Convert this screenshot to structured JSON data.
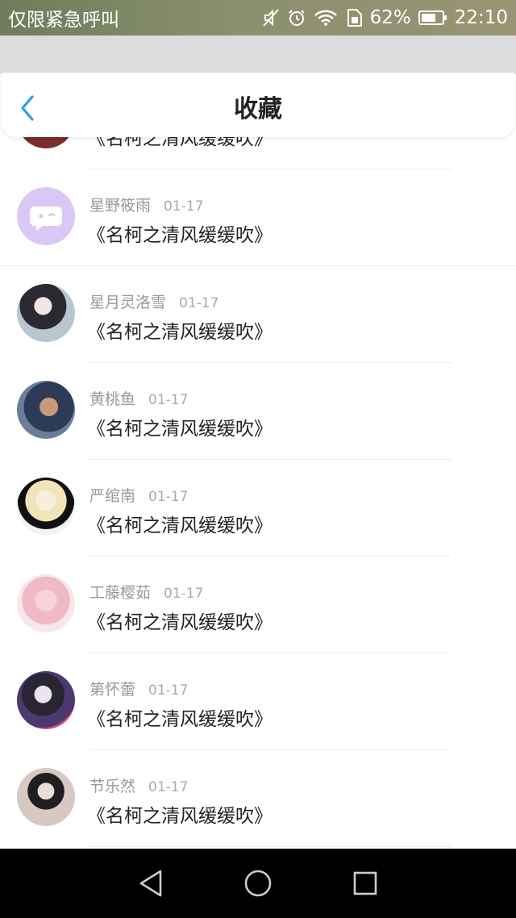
{
  "status_bar": {
    "carrier": "仅限紧急呼叫",
    "battery_percent": "62%",
    "time": "22:10",
    "icons": [
      "mute-icon",
      "alarm-icon",
      "wifi-icon",
      "sim-icon",
      "battery-icon"
    ]
  },
  "header": {
    "title": "收藏",
    "back_icon": "chevron-left-icon",
    "accent_color": "#2a9df4"
  },
  "favorites": [
    {
      "user": "",
      "date": "",
      "work": "《名柯之清风缓缓吹》"
    },
    {
      "user": "星野筱雨",
      "date": "01-17",
      "work": "《名柯之清风缓缓吹》"
    },
    {
      "user": "星月灵洛雪",
      "date": "01-17",
      "work": "《名柯之清风缓缓吹》"
    },
    {
      "user": "黄桃鱼",
      "date": "01-17",
      "work": "《名柯之清风缓缓吹》"
    },
    {
      "user": "严绾南",
      "date": "01-17",
      "work": "《名柯之清风缓缓吹》"
    },
    {
      "user": "工藤樱茹",
      "date": "01-17",
      "work": "《名柯之清风缓缓吹》"
    },
    {
      "user": "第怀蕾",
      "date": "01-17",
      "work": "《名柯之清风缓缓吹》"
    },
    {
      "user": "节乐然",
      "date": "01-17",
      "work": "《名柯之清风缓缓吹》"
    }
  ],
  "nav_bar": {
    "buttons": [
      "back-triangle-icon",
      "home-circle-icon",
      "recents-square-icon"
    ]
  }
}
